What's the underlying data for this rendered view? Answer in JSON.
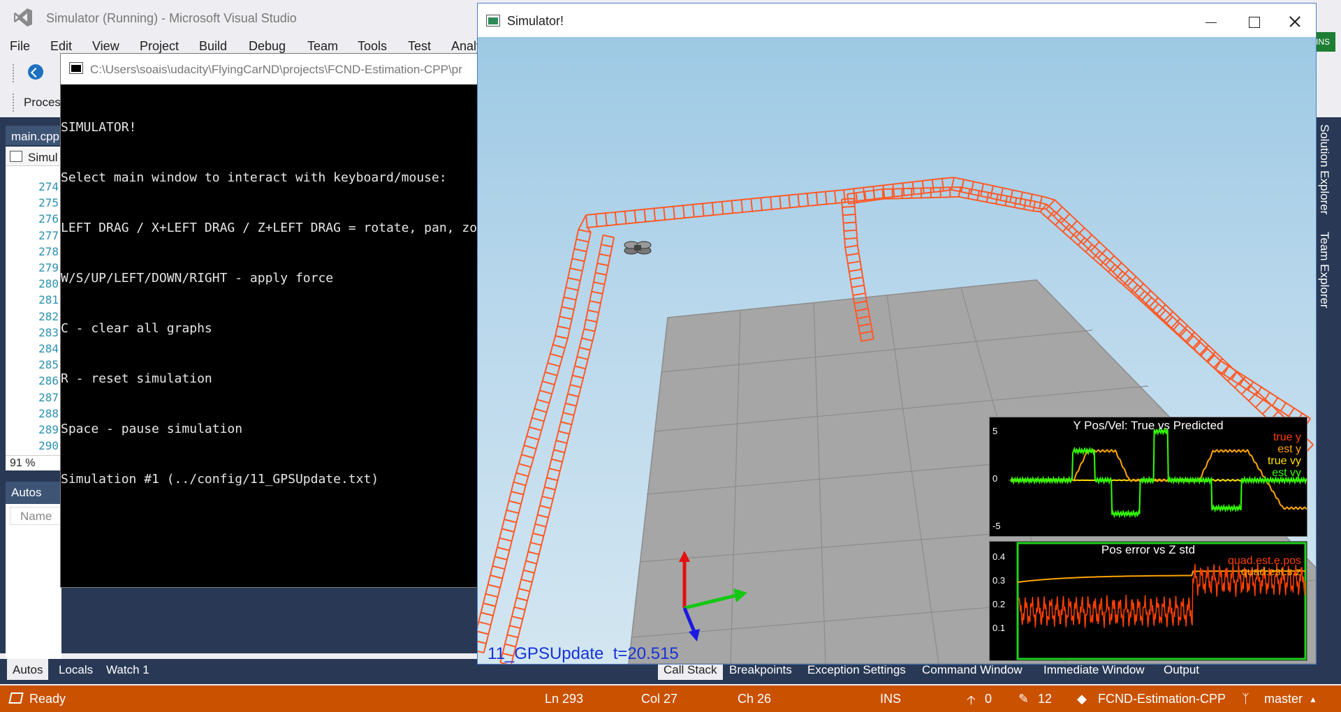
{
  "vs": {
    "title": "Simulator (Running) - Microsoft Visual Studio",
    "menu": [
      "File",
      "Edit",
      "View",
      "Project",
      "Build",
      "Debug",
      "Team",
      "Tools",
      "Test",
      "Analy"
    ],
    "toolbar2_label": "Proces",
    "ins_chip": "INS",
    "editor_tab": "main.cpp",
    "breadcrumb": "Simul",
    "line_numbers": [
      "274",
      "275",
      "276",
      "277",
      "278",
      "279",
      "280",
      "281",
      "282",
      "283",
      "284",
      "285",
      "286",
      "287",
      "288",
      "289",
      "290"
    ],
    "zoom": "91 %",
    "autos_header": "Autos",
    "autos_col_name": "Name",
    "bottom_tabs_left": [
      "Autos",
      "Locals",
      "Watch 1"
    ],
    "bottom_tabs_right": [
      "Call Stack",
      "Breakpoints",
      "Exception Settings",
      "Command Window",
      "Immediate Window",
      "Output"
    ],
    "right_tabs": [
      "Solution Explorer",
      "Team Explorer"
    ]
  },
  "statusbar": {
    "ready": "Ready",
    "ln": "Ln 293",
    "col": "Col 27",
    "ch": "Ch 26",
    "ins": "INS",
    "up_count": "0",
    "pencil_count": "12",
    "repo": "FCND-Estimation-CPP",
    "branch": "master"
  },
  "console": {
    "title": "C:\\Users\\soais\\udacity\\FlyingCarND\\projects\\FCND-Estimation-CPP\\pr",
    "lines": [
      "SIMULATOR!",
      "Select main window to interact with keyboard/mouse:",
      "LEFT DRAG / X+LEFT DRAG / Z+LEFT DRAG = rotate, pan, zo",
      "W/S/UP/LEFT/DOWN/RIGHT - apply force",
      "C - clear all graphs",
      "R - reset simulation",
      "Space - pause simulation",
      "Simulation #1 (../config/11_GPSUpdate.txt)"
    ]
  },
  "simulator": {
    "title": "Simulator!",
    "scenario": "11_GPSUpdate",
    "time_label": "t=20.515",
    "graph1": {
      "title": "Y Pos/Vel: True vs Predicted",
      "y_ticks": [
        "5",
        "0",
        "-5"
      ],
      "legend": [
        {
          "label": "true y",
          "color": "#ff4000"
        },
        {
          "label": "est y",
          "color": "#ffa500"
        },
        {
          "label": "true vy",
          "color": "#ffe100"
        },
        {
          "label": "est vy",
          "color": "#33ff00"
        }
      ]
    },
    "graph2": {
      "title": "Pos error vs Z std",
      "y_ticks": [
        "0.4",
        "0.3",
        "0.2",
        "0.1"
      ],
      "legend": [
        {
          "label": "quad.est.e.pos",
          "color": "#ff4000"
        },
        {
          "label": "quad.est.s.z",
          "color": "#ffa500"
        }
      ]
    },
    "colors": {
      "trajectory": "#ff5a28",
      "grid_floor": "#a6a6a6",
      "status_text": "#1533d6"
    }
  }
}
